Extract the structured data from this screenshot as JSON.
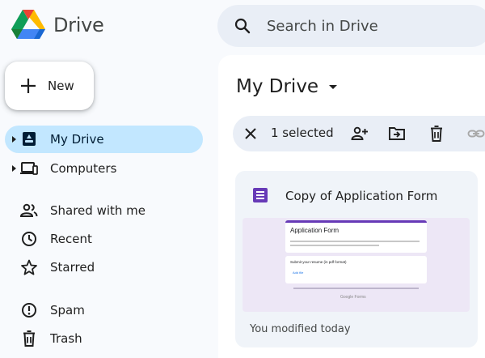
{
  "header": {
    "app_title": "Drive",
    "search_placeholder": "Search in Drive"
  },
  "new_button": {
    "label": "New"
  },
  "sidebar": {
    "items": [
      {
        "label": "My Drive",
        "icon": "my-drive-icon",
        "active": true,
        "expandable": true
      },
      {
        "label": "Computers",
        "icon": "computers-icon",
        "active": false,
        "expandable": true
      },
      {
        "label": "Shared with me",
        "icon": "people-icon",
        "active": false
      },
      {
        "label": "Recent",
        "icon": "clock-icon",
        "active": false
      },
      {
        "label": "Starred",
        "icon": "star-icon",
        "active": false
      },
      {
        "label": "Spam",
        "icon": "spam-icon",
        "active": false
      },
      {
        "label": "Trash",
        "icon": "trash-icon",
        "active": false
      }
    ]
  },
  "main": {
    "title": "My Drive",
    "selection_bar": {
      "count_label": "1 selected",
      "actions": [
        "close-icon",
        "share-icon",
        "move-icon",
        "trash-icon",
        "link-icon"
      ]
    },
    "file_card": {
      "name": "Copy of Application Form",
      "file_type_icon": "google-forms-icon",
      "modified": "You modified today",
      "thumbnail": {
        "form_title": "Application Form",
        "question_label": "Submit your resume (in pdf format)",
        "file_button": "Add file",
        "footer": "Google Forms"
      }
    }
  },
  "colors": {
    "active_nav": "#c2e7ff",
    "search_bg": "#e9eef6",
    "forms_purple": "#673ab7",
    "card_bg": "#f0f4f9"
  }
}
